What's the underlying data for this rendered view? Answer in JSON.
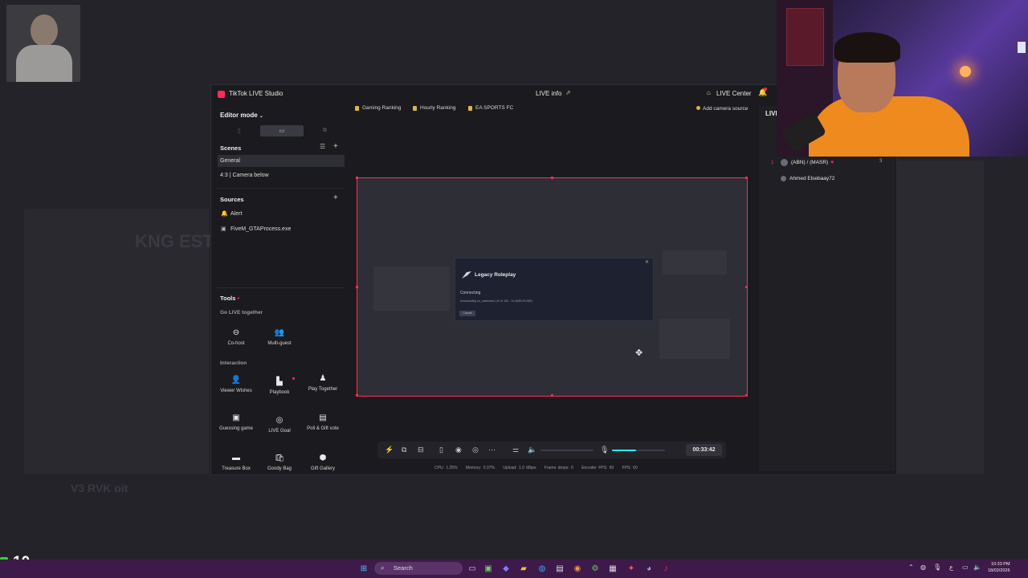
{
  "background": {
    "ghost_text_1": "KNG ESTA",
    "ghost_text_2": "V3 RVK oit"
  },
  "app": {
    "title": "TikTok LIVE Studio",
    "header_center": "LIVE info",
    "live_center": "LIVE Center",
    "accent": "#fe2c55"
  },
  "left": {
    "editor_mode": "Editor mode",
    "scenes_title": "Scenes",
    "scenes": [
      "General",
      "4:3 | Camera below"
    ],
    "sources_title": "Sources",
    "sources": [
      {
        "icon": "bell-icon",
        "label": "Alert"
      },
      {
        "icon": "window-icon",
        "label": "FiveM_GTAProcess.exe"
      }
    ],
    "tools_title": "Tools",
    "go_live_together": "Go LIVE together",
    "cohost": "Co-host",
    "multiguest": "Multi-guest",
    "interaction": "Interaction",
    "tools": [
      {
        "label": "Viewer Wishes"
      },
      {
        "label": "Playbook"
      },
      {
        "label": "Play Together"
      },
      {
        "label": "Guessing game"
      },
      {
        "label": "LIVE Goal"
      },
      {
        "label": "Poll & Gift vote"
      },
      {
        "label": "Treasure Box"
      },
      {
        "label": "Goody Bag"
      },
      {
        "label": "Gift Gallery"
      }
    ]
  },
  "rankings": [
    "Gaming Ranking",
    "Hourly Ranking",
    "EA SPORTS FC"
  ],
  "add_camera": "Add camera source",
  "dialog": {
    "title": "Legacy Roleplay",
    "status": "Connecting",
    "detail": "Downloading us_mainmenu (10 of 163 - 10.46/80.00 MiB)",
    "button": "Cancel"
  },
  "control": {
    "timer": "00:33:42",
    "volume_fraction": 0.45
  },
  "stats": {
    "cpu": "CPU: 1.25%",
    "memory": "Memory: 0.37%",
    "upload": "Upload: 1.0 Mbps",
    "frame_drops": "Frame drops: 0",
    "encoder_fps": "Encoder FPS: 60",
    "fps": "FPS: 60"
  },
  "right": {
    "live_label": "LIVE",
    "ranking": [
      {
        "rank": "1",
        "name": "(ABN) / (MASR)",
        "count": "3"
      },
      {
        "rank": "",
        "name": "Ahmed Elsebaay72",
        "count": ""
      }
    ]
  },
  "counter": "10",
  "taskbar": {
    "search": "Search",
    "time": "10:33 PM",
    "date": "18/02/2026"
  }
}
